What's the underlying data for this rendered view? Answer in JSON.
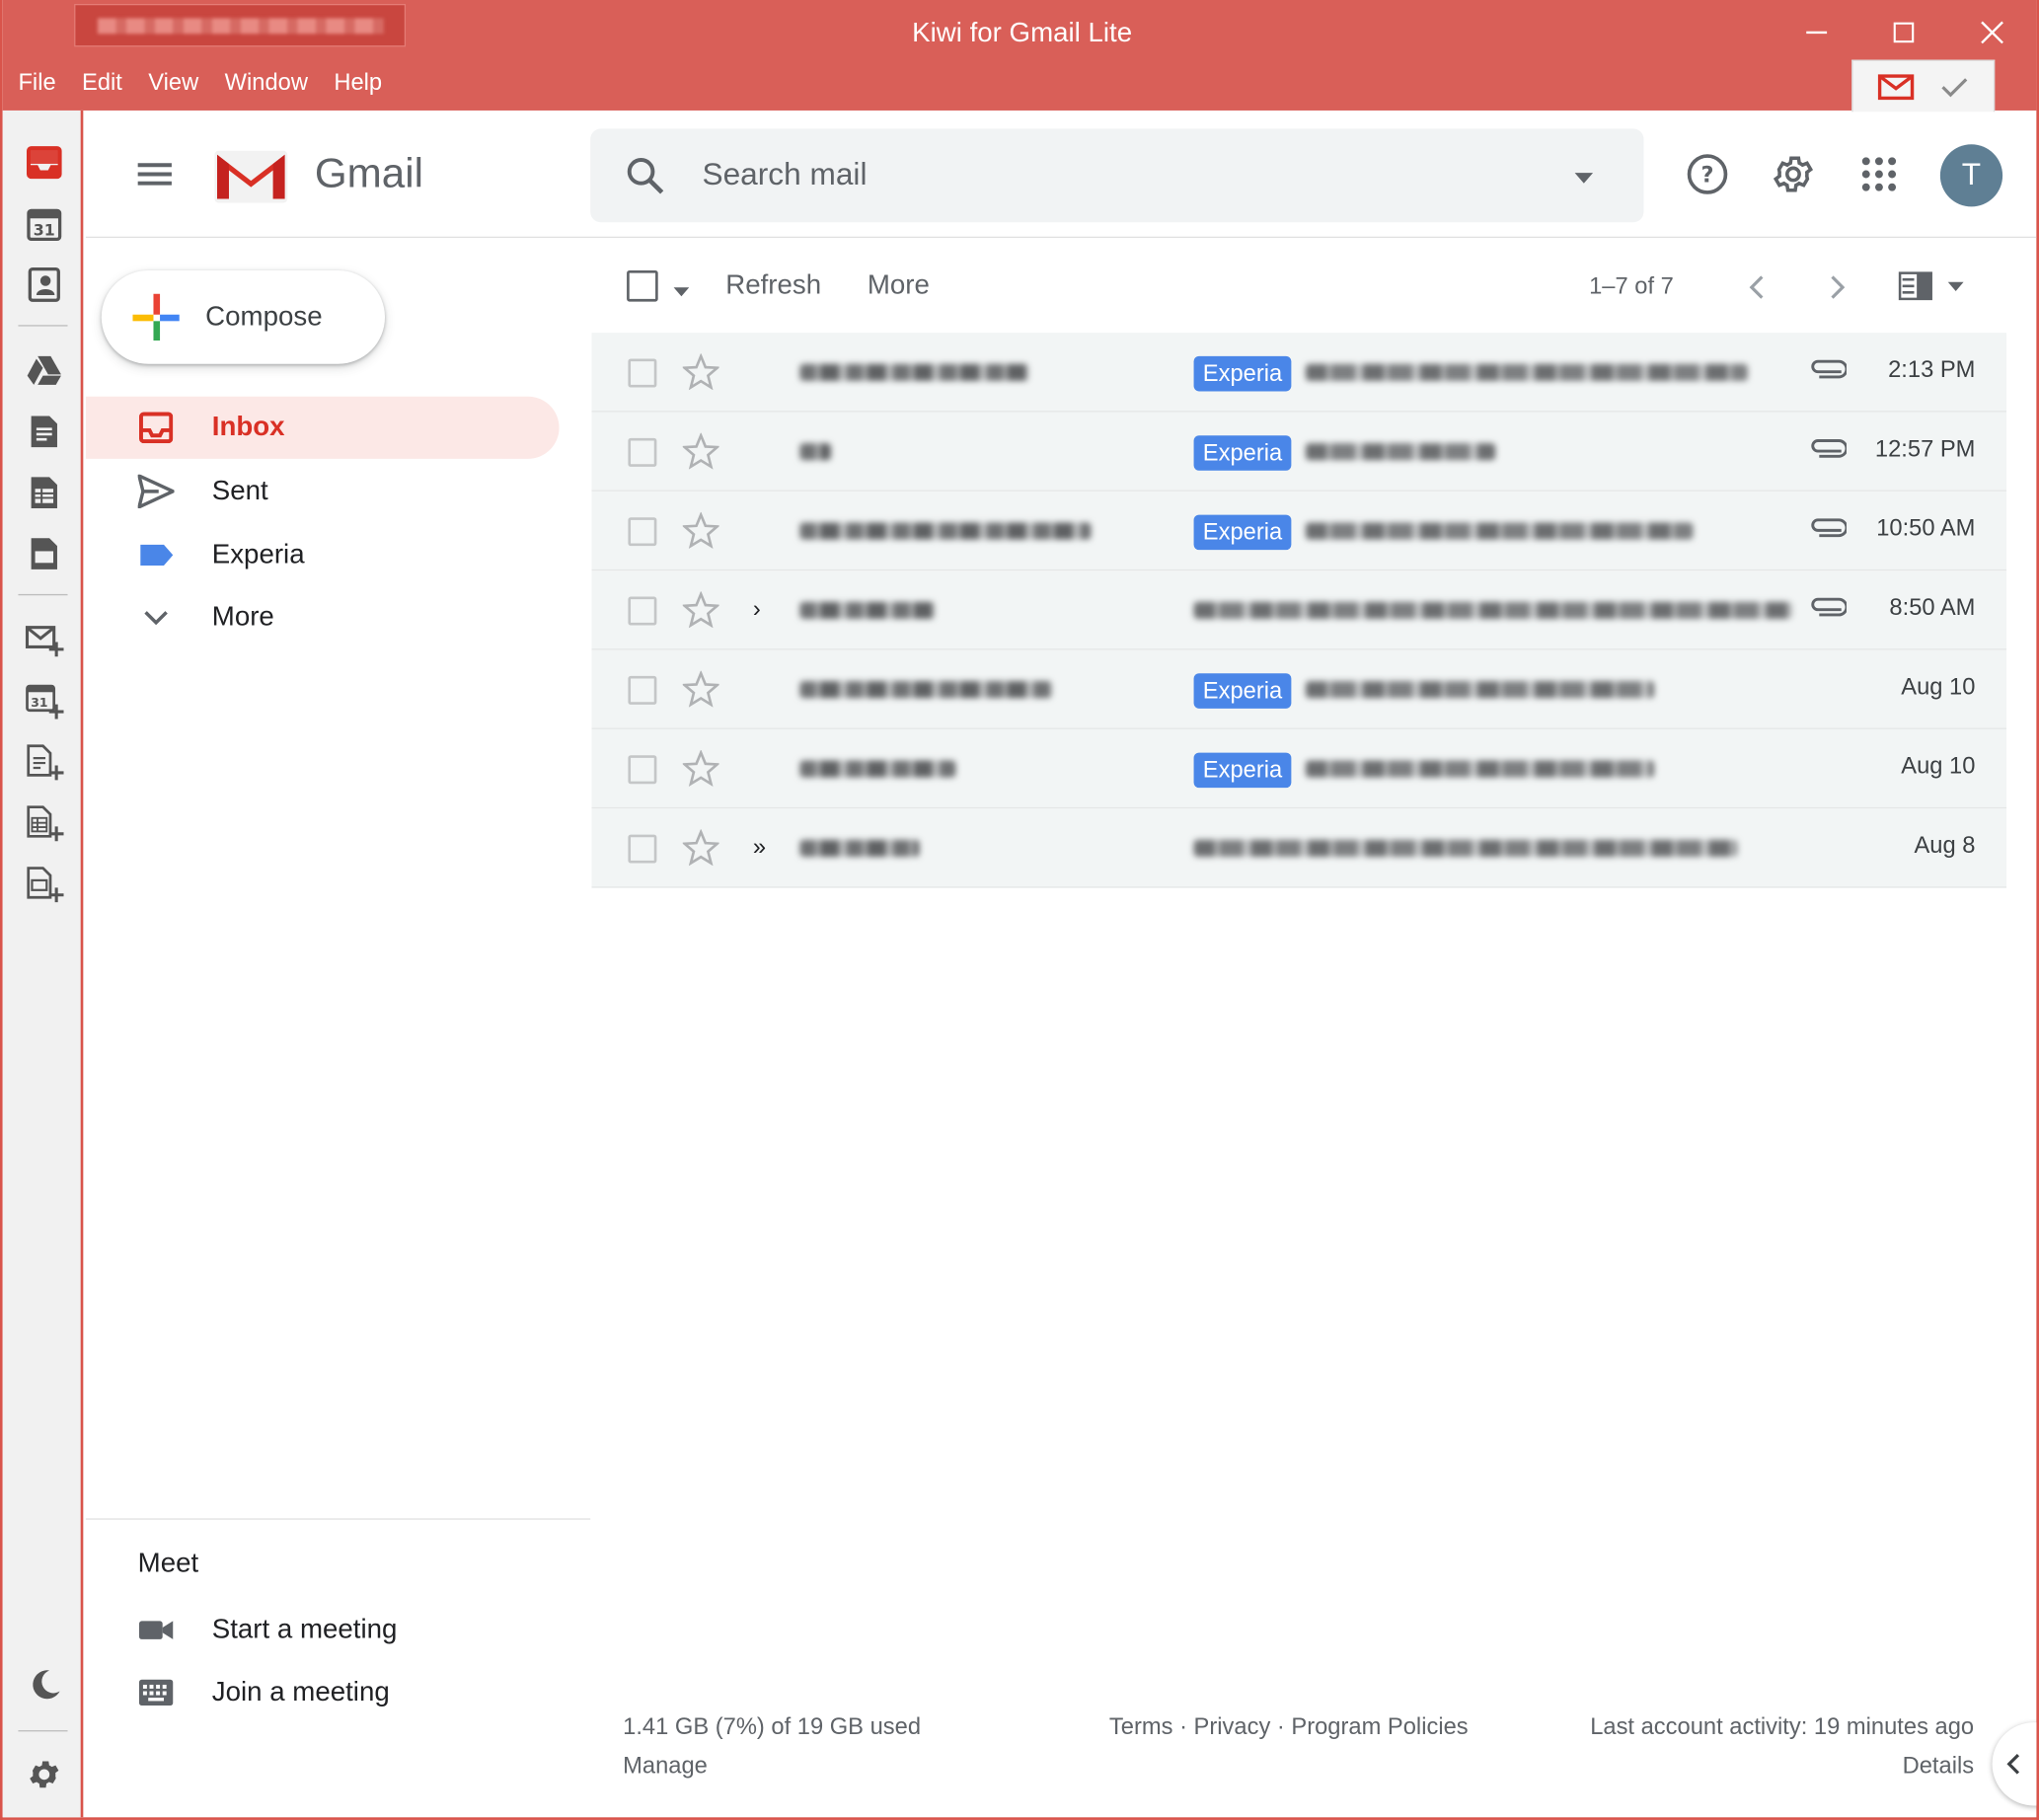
{
  "window": {
    "title": "Kiwi for Gmail Lite",
    "menu": [
      "File",
      "Edit",
      "View",
      "Window",
      "Help"
    ]
  },
  "header": {
    "app_name": "Gmail",
    "search_placeholder": "Search mail",
    "avatar_initial": "T"
  },
  "sidebar": {
    "compose_label": "Compose",
    "items": [
      {
        "label": "Inbox",
        "icon": "inbox-icon",
        "active": true
      },
      {
        "label": "Sent",
        "icon": "send-icon"
      },
      {
        "label": "Experia",
        "icon": "label-icon"
      },
      {
        "label": "More",
        "icon": "chevron-down-icon"
      }
    ],
    "meet": {
      "title": "Meet",
      "start": "Start a meeting",
      "join": "Join a meeting"
    }
  },
  "toolbar": {
    "refresh": "Refresh",
    "more": "More",
    "range": "1–7 of 7"
  },
  "emails": [
    {
      "label": "Experia",
      "attachment": true,
      "date": "2:13 PM",
      "marker": ""
    },
    {
      "label": "Experia",
      "attachment": true,
      "date": "12:57 PM",
      "marker": ""
    },
    {
      "label": "Experia",
      "attachment": true,
      "date": "10:50 AM",
      "marker": ""
    },
    {
      "label": "",
      "attachment": true,
      "date": "8:50 AM",
      "marker": "›"
    },
    {
      "label": "Experia",
      "attachment": false,
      "date": "Aug 10",
      "marker": ""
    },
    {
      "label": "Experia",
      "attachment": false,
      "date": "Aug 10",
      "marker": ""
    },
    {
      "label": "",
      "attachment": false,
      "date": "Aug 8",
      "marker": "»"
    }
  ],
  "footer": {
    "storage": "1.41 GB (7%) of 19 GB used",
    "manage": "Manage",
    "terms": "Terms",
    "privacy": "Privacy",
    "policies": "Program Policies",
    "activity": "Last account activity: 19 minutes ago",
    "details": "Details",
    "sep": "·"
  },
  "colors": {
    "accent": "#d95f58",
    "label_experia": "#4a86e8",
    "inbox_active": "#d93025"
  }
}
